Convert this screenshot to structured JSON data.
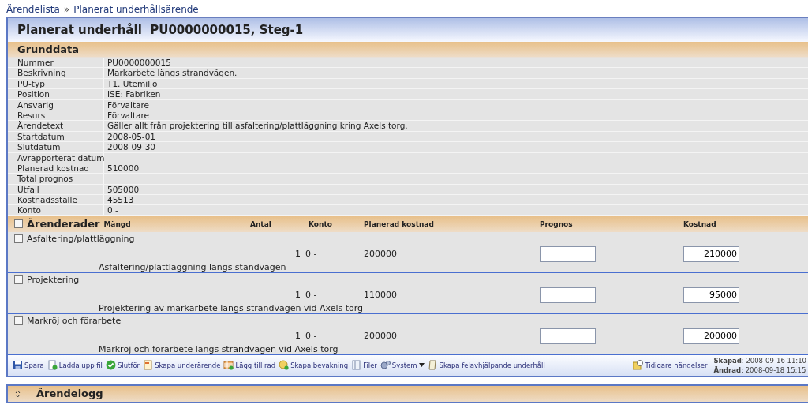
{
  "breadcrumb": [
    {
      "label": "Ärendelista"
    },
    {
      "label": "»"
    },
    {
      "label": "Planerat underhållsärende"
    }
  ],
  "title": "Planerat underhåll  PU0000000015, Steg-1",
  "grunddata": {
    "heading": "Grunddata",
    "fields": [
      {
        "label": "Nummer",
        "value": "PU0000000015"
      },
      {
        "label": "Beskrivning",
        "value": "Markarbete längs strandvägen."
      },
      {
        "label": "PU-typ",
        "value": "T1. Utemiljö"
      },
      {
        "label": "Position",
        "value": "ISE: Fabriken"
      },
      {
        "label": "Ansvarig",
        "value": "Förvaltare"
      },
      {
        "label": "Resurs",
        "value": "Förvaltare"
      },
      {
        "label": "Ärendetext",
        "value": "Gäller allt från projektering till asfaltering/plattläggning kring Axels torg."
      },
      {
        "label": "Startdatum",
        "value": "2008-05-01"
      },
      {
        "label": "Slutdatum",
        "value": "2008-09-30"
      },
      {
        "label": "Avrapporterat datum"
      },
      {
        "label": "Planerad kostnad",
        "value": "510000"
      },
      {
        "label": "Total prognos"
      },
      {
        "label": "Utfall",
        "value": "505000"
      },
      {
        "label": "Kostnadsställe",
        "value": "45513"
      },
      {
        "label": "Konto",
        "value": "0 -"
      }
    ]
  },
  "arenderader": {
    "heading": "Ärenderader",
    "all_checked": false,
    "columns": [
      "Mängd",
      "Antal",
      "Konto",
      "Planerad kostnad",
      "Prognos",
      "Kostnad"
    ],
    "rows": [
      {
        "title": "Asfaltering/plattläggning",
        "checked": false,
        "antal": "1",
        "konto": "0 -",
        "planerad_kostnad": "200000",
        "kostnad": "210000",
        "description": "Asfaltering/plattläggning längs standvägen"
      },
      {
        "title": "Projektering",
        "checked": false,
        "antal": "1",
        "konto": "0 -",
        "planerad_kostnad": "110000",
        "kostnad": "95000",
        "description": "Projektering av markarbete längs strandvägen vid Axels torg"
      },
      {
        "title": "Markröj och förarbete",
        "checked": false,
        "antal": "1",
        "konto": "0 -",
        "planerad_kostnad": "200000",
        "kostnad": "200000",
        "description": "Markröj och förarbete längs strandvägen vid Axels torg"
      }
    ]
  },
  "toolbar": {
    "actions": [
      {
        "kind": "save",
        "label": "Spara"
      },
      {
        "kind": "upload",
        "label": "Ladda upp fil"
      },
      {
        "kind": "finish",
        "label": "Slutför"
      },
      {
        "kind": "subcase",
        "label": "Skapa underärende"
      },
      {
        "kind": "addrow",
        "label": "Lägg till rad"
      },
      {
        "kind": "watch",
        "label": "Skapa bevakning"
      },
      {
        "kind": "files",
        "label": "Filer"
      },
      {
        "kind": "system",
        "label": "System",
        "dropdown": true
      },
      {
        "kind": "corrective",
        "label": "Skapa felavhjälpande underhåll"
      }
    ],
    "history": {
      "label": "Tidigare händelser"
    },
    "created": {
      "label": "Skapad",
      "value": ": 2008-09-16 11:10"
    },
    "changed": {
      "label": "Ändrad",
      "value": ": 2008-09-18 15:15"
    }
  },
  "log": {
    "heading": "Ärendelogg",
    "expanded": false
  }
}
